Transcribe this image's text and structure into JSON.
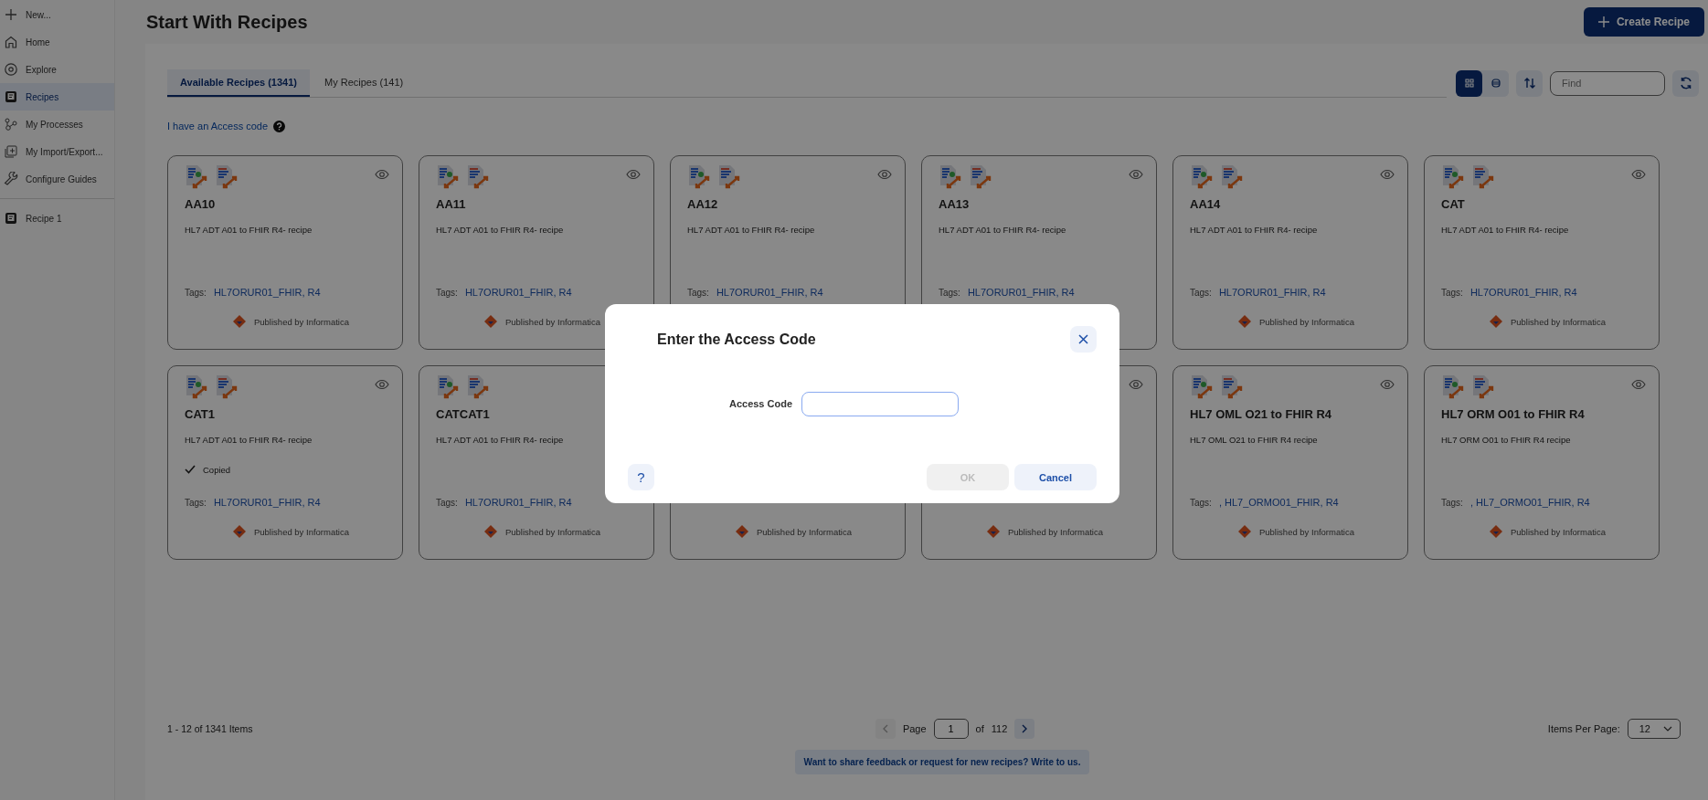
{
  "sidebar": {
    "items": [
      {
        "label": "New...",
        "selected": false
      },
      {
        "label": "Home",
        "selected": false
      },
      {
        "label": "Explore",
        "selected": false
      },
      {
        "label": "Recipes",
        "selected": true
      },
      {
        "label": "My Processes",
        "selected": false
      },
      {
        "label": "My Import/Export...",
        "selected": false
      },
      {
        "label": "Configure Guides",
        "selected": false
      }
    ],
    "open_items": [
      {
        "label": "Recipe 1",
        "selected": false
      }
    ]
  },
  "header": {
    "title": "Start With Recipes",
    "create_button": "Create Recipe"
  },
  "tabs": [
    {
      "label": "Available Recipes (1341)",
      "selected": true
    },
    {
      "label": "My Recipes (141)",
      "selected": false
    }
  ],
  "toolbar": {
    "views": [
      {
        "kind": "grid",
        "selected": true
      },
      {
        "kind": "list",
        "selected": false
      }
    ],
    "search": {
      "placeholder": "Find"
    }
  },
  "access_code_link": "I have an Access code",
  "cards": [
    {
      "title": "AA10",
      "description": "HL7 ADT A01 to FHIR R4- recipe",
      "tags_label": "Tags:",
      "tags": "HL7ORUR01_FHIR, R4",
      "publisher": "Published by Informatica"
    },
    {
      "title": "AA11",
      "description": "HL7 ADT A01 to FHIR R4- recipe",
      "tags_label": "Tags:",
      "tags": "HL7ORUR01_FHIR, R4",
      "publisher": "Published by Informatica"
    },
    {
      "title": "AA12",
      "description": "HL7 ADT A01 to FHIR R4- recipe",
      "tags_label": "Tags:",
      "tags": "HL7ORUR01_FHIR, R4"
    },
    {
      "title": "AA13",
      "description": "HL7 ADT A01 to FHIR R4- recipe",
      "tags_label": "Tags:",
      "tags": "HL7ORUR01_FHIR, R4"
    },
    {
      "title": "AA14",
      "description": "HL7 ADT A01 to FHIR R4- recipe",
      "tags_label": "Tags:",
      "tags": "HL7ORUR01_FHIR, R4",
      "publisher": "Published by Informatica"
    },
    {
      "title": "CAT",
      "description": "HL7 ADT A01 to FHIR R4- recipe",
      "tags_label": "Tags:",
      "tags": "HL7ORUR01_FHIR, R4",
      "publisher": "Published by Informatica"
    },
    {
      "title": "CAT1",
      "description": "HL7 ADT A01 to FHIR R4- recipe",
      "copied": "Copied",
      "tags_label": "Tags:",
      "tags": "HL7ORUR01_FHIR, R4",
      "publisher": "Published by Informatica"
    },
    {
      "title": "CATCAT1",
      "description": "HL7 ADT A01 to FHIR R4- recipe",
      "tags_label": "Tags:",
      "tags": "HL7ORUR01_FHIR, R4",
      "publisher": "Published by Informatica"
    },
    {
      "publisher": "Published by Informatica"
    },
    {
      "publisher": "Published by Informatica"
    },
    {
      "title": "HL7 OML O21 to FHIR R4",
      "description": "HL7 OML O21 to FHIR R4 recipe",
      "tags_label": "Tags:",
      "tags": ", HL7_ORMO01_FHIR, R4",
      "publisher": "Published by Informatica"
    },
    {
      "title": "HL7 ORM O01 to FHIR R4",
      "description": "HL7 ORM O01 to FHIR R4 recipe",
      "tags_label": "Tags:",
      "tags": ", HL7_ORMO01_FHIR, R4",
      "publisher": "Published by Informatica"
    }
  ],
  "footer": {
    "range": "1 - 12 of 1341 Items",
    "page_label": "Page",
    "page": "1",
    "of_label": "of",
    "total_pages": "112",
    "per_page_label": "Items Per Page:",
    "per_page": "12",
    "feedback": "Want to share feedback or request for new recipes? Write to us."
  },
  "dialog": {
    "title": "Enter the Access Code",
    "field_label": "Access Code",
    "ok": {
      "label": "OK",
      "disabled": true
    },
    "cancel": "Cancel",
    "help": "?"
  }
}
